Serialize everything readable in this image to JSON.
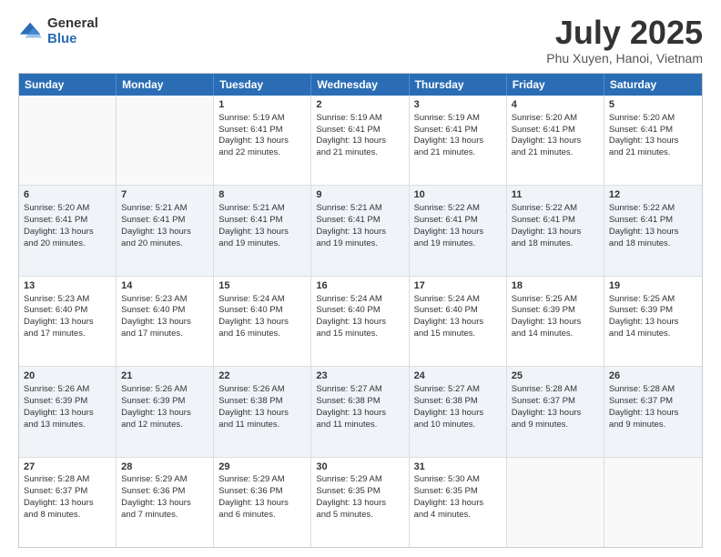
{
  "logo": {
    "general": "General",
    "blue": "Blue"
  },
  "title": "July 2025",
  "subtitle": "Phu Xuyen, Hanoi, Vietnam",
  "weekdays": [
    "Sunday",
    "Monday",
    "Tuesday",
    "Wednesday",
    "Thursday",
    "Friday",
    "Saturday"
  ],
  "weeks": [
    [
      {
        "day": "",
        "sunrise": "",
        "sunset": "",
        "daylight": ""
      },
      {
        "day": "",
        "sunrise": "",
        "sunset": "",
        "daylight": ""
      },
      {
        "day": "1",
        "sunrise": "Sunrise: 5:19 AM",
        "sunset": "Sunset: 6:41 PM",
        "daylight": "Daylight: 13 hours and 22 minutes."
      },
      {
        "day": "2",
        "sunrise": "Sunrise: 5:19 AM",
        "sunset": "Sunset: 6:41 PM",
        "daylight": "Daylight: 13 hours and 21 minutes."
      },
      {
        "day": "3",
        "sunrise": "Sunrise: 5:19 AM",
        "sunset": "Sunset: 6:41 PM",
        "daylight": "Daylight: 13 hours and 21 minutes."
      },
      {
        "day": "4",
        "sunrise": "Sunrise: 5:20 AM",
        "sunset": "Sunset: 6:41 PM",
        "daylight": "Daylight: 13 hours and 21 minutes."
      },
      {
        "day": "5",
        "sunrise": "Sunrise: 5:20 AM",
        "sunset": "Sunset: 6:41 PM",
        "daylight": "Daylight: 13 hours and 21 minutes."
      }
    ],
    [
      {
        "day": "6",
        "sunrise": "Sunrise: 5:20 AM",
        "sunset": "Sunset: 6:41 PM",
        "daylight": "Daylight: 13 hours and 20 minutes."
      },
      {
        "day": "7",
        "sunrise": "Sunrise: 5:21 AM",
        "sunset": "Sunset: 6:41 PM",
        "daylight": "Daylight: 13 hours and 20 minutes."
      },
      {
        "day": "8",
        "sunrise": "Sunrise: 5:21 AM",
        "sunset": "Sunset: 6:41 PM",
        "daylight": "Daylight: 13 hours and 19 minutes."
      },
      {
        "day": "9",
        "sunrise": "Sunrise: 5:21 AM",
        "sunset": "Sunset: 6:41 PM",
        "daylight": "Daylight: 13 hours and 19 minutes."
      },
      {
        "day": "10",
        "sunrise": "Sunrise: 5:22 AM",
        "sunset": "Sunset: 6:41 PM",
        "daylight": "Daylight: 13 hours and 19 minutes."
      },
      {
        "day": "11",
        "sunrise": "Sunrise: 5:22 AM",
        "sunset": "Sunset: 6:41 PM",
        "daylight": "Daylight: 13 hours and 18 minutes."
      },
      {
        "day": "12",
        "sunrise": "Sunrise: 5:22 AM",
        "sunset": "Sunset: 6:41 PM",
        "daylight": "Daylight: 13 hours and 18 minutes."
      }
    ],
    [
      {
        "day": "13",
        "sunrise": "Sunrise: 5:23 AM",
        "sunset": "Sunset: 6:40 PM",
        "daylight": "Daylight: 13 hours and 17 minutes."
      },
      {
        "day": "14",
        "sunrise": "Sunrise: 5:23 AM",
        "sunset": "Sunset: 6:40 PM",
        "daylight": "Daylight: 13 hours and 17 minutes."
      },
      {
        "day": "15",
        "sunrise": "Sunrise: 5:24 AM",
        "sunset": "Sunset: 6:40 PM",
        "daylight": "Daylight: 13 hours and 16 minutes."
      },
      {
        "day": "16",
        "sunrise": "Sunrise: 5:24 AM",
        "sunset": "Sunset: 6:40 PM",
        "daylight": "Daylight: 13 hours and 15 minutes."
      },
      {
        "day": "17",
        "sunrise": "Sunrise: 5:24 AM",
        "sunset": "Sunset: 6:40 PM",
        "daylight": "Daylight: 13 hours and 15 minutes."
      },
      {
        "day": "18",
        "sunrise": "Sunrise: 5:25 AM",
        "sunset": "Sunset: 6:39 PM",
        "daylight": "Daylight: 13 hours and 14 minutes."
      },
      {
        "day": "19",
        "sunrise": "Sunrise: 5:25 AM",
        "sunset": "Sunset: 6:39 PM",
        "daylight": "Daylight: 13 hours and 14 minutes."
      }
    ],
    [
      {
        "day": "20",
        "sunrise": "Sunrise: 5:26 AM",
        "sunset": "Sunset: 6:39 PM",
        "daylight": "Daylight: 13 hours and 13 minutes."
      },
      {
        "day": "21",
        "sunrise": "Sunrise: 5:26 AM",
        "sunset": "Sunset: 6:39 PM",
        "daylight": "Daylight: 13 hours and 12 minutes."
      },
      {
        "day": "22",
        "sunrise": "Sunrise: 5:26 AM",
        "sunset": "Sunset: 6:38 PM",
        "daylight": "Daylight: 13 hours and 11 minutes."
      },
      {
        "day": "23",
        "sunrise": "Sunrise: 5:27 AM",
        "sunset": "Sunset: 6:38 PM",
        "daylight": "Daylight: 13 hours and 11 minutes."
      },
      {
        "day": "24",
        "sunrise": "Sunrise: 5:27 AM",
        "sunset": "Sunset: 6:38 PM",
        "daylight": "Daylight: 13 hours and 10 minutes."
      },
      {
        "day": "25",
        "sunrise": "Sunrise: 5:28 AM",
        "sunset": "Sunset: 6:37 PM",
        "daylight": "Daylight: 13 hours and 9 minutes."
      },
      {
        "day": "26",
        "sunrise": "Sunrise: 5:28 AM",
        "sunset": "Sunset: 6:37 PM",
        "daylight": "Daylight: 13 hours and 9 minutes."
      }
    ],
    [
      {
        "day": "27",
        "sunrise": "Sunrise: 5:28 AM",
        "sunset": "Sunset: 6:37 PM",
        "daylight": "Daylight: 13 hours and 8 minutes."
      },
      {
        "day": "28",
        "sunrise": "Sunrise: 5:29 AM",
        "sunset": "Sunset: 6:36 PM",
        "daylight": "Daylight: 13 hours and 7 minutes."
      },
      {
        "day": "29",
        "sunrise": "Sunrise: 5:29 AM",
        "sunset": "Sunset: 6:36 PM",
        "daylight": "Daylight: 13 hours and 6 minutes."
      },
      {
        "day": "30",
        "sunrise": "Sunrise: 5:29 AM",
        "sunset": "Sunset: 6:35 PM",
        "daylight": "Daylight: 13 hours and 5 minutes."
      },
      {
        "day": "31",
        "sunrise": "Sunrise: 5:30 AM",
        "sunset": "Sunset: 6:35 PM",
        "daylight": "Daylight: 13 hours and 4 minutes."
      },
      {
        "day": "",
        "sunrise": "",
        "sunset": "",
        "daylight": ""
      },
      {
        "day": "",
        "sunrise": "",
        "sunset": "",
        "daylight": ""
      }
    ]
  ]
}
